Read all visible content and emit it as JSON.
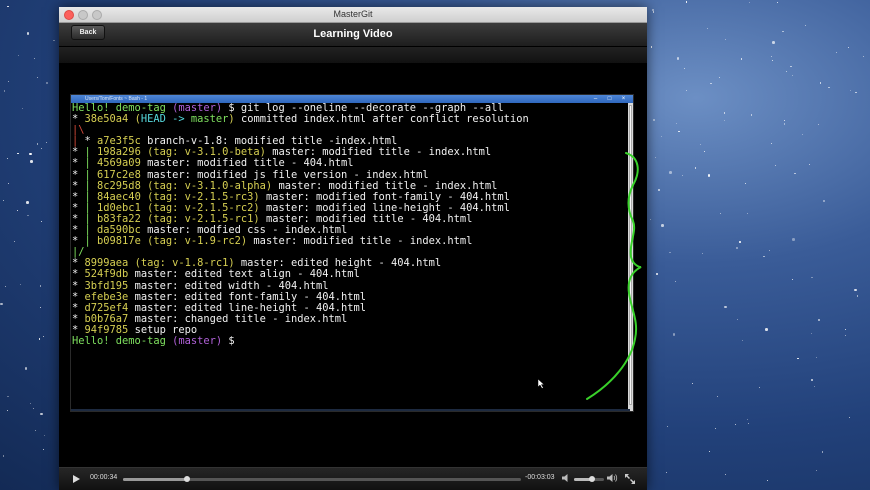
{
  "window": {
    "title": "MasterGit"
  },
  "toolbar": {
    "back_label": "Back",
    "page_title": "Learning Video"
  },
  "terminal": {
    "title": "Users/Tom/Fonts ~ Bash - 1",
    "lines": [
      [
        {
          "t": "Hello! demo-tag ",
          "c": "green"
        },
        {
          "t": "(master)",
          "c": "purple"
        },
        {
          "t": " $ git log --oneline --decorate --graph --all",
          "c": "white"
        }
      ],
      [
        {
          "t": "* ",
          "c": "white"
        },
        {
          "t": "38e50a4 ",
          "c": "yellow"
        },
        {
          "t": "(",
          "c": "yellow"
        },
        {
          "t": "HEAD -> ",
          "c": "cyan"
        },
        {
          "t": "master",
          "c": "green"
        },
        {
          "t": ")",
          "c": "yellow"
        },
        {
          "t": " committed index.html after conflict resolution",
          "c": "white"
        }
      ],
      [
        {
          "t": "|\\",
          "c": "red"
        }
      ],
      [
        {
          "t": "| ",
          "c": "red"
        },
        {
          "t": "* ",
          "c": "white"
        },
        {
          "t": "a7e3f5c ",
          "c": "yellow"
        },
        {
          "t": "branch-v-1.8: modified title -index.html",
          "c": "white"
        }
      ],
      [
        {
          "t": "* ",
          "c": "white"
        },
        {
          "t": "| ",
          "c": "green"
        },
        {
          "t": "198a296 ",
          "c": "yellow"
        },
        {
          "t": "(tag: v-3.1.0-beta)",
          "c": "yellow"
        },
        {
          "t": " master: modified title - index.html",
          "c": "white"
        }
      ],
      [
        {
          "t": "* ",
          "c": "white"
        },
        {
          "t": "| ",
          "c": "green"
        },
        {
          "t": "4569a09 ",
          "c": "yellow"
        },
        {
          "t": "master: modified title - 404.html",
          "c": "white"
        }
      ],
      [
        {
          "t": "* ",
          "c": "white"
        },
        {
          "t": "| ",
          "c": "green"
        },
        {
          "t": "617c2e8 ",
          "c": "yellow"
        },
        {
          "t": "master: modified js file version - index.html",
          "c": "white"
        }
      ],
      [
        {
          "t": "* ",
          "c": "white"
        },
        {
          "t": "| ",
          "c": "green"
        },
        {
          "t": "8c295d8 ",
          "c": "yellow"
        },
        {
          "t": "(tag: v-3.1.0-alpha)",
          "c": "yellow"
        },
        {
          "t": " master: modified title - index.html",
          "c": "white"
        }
      ],
      [
        {
          "t": "* ",
          "c": "white"
        },
        {
          "t": "| ",
          "c": "green"
        },
        {
          "t": "84aec40 ",
          "c": "yellow"
        },
        {
          "t": "(tag: v-2.1.5-rc3)",
          "c": "yellow"
        },
        {
          "t": " master: modified font-family - 404.html",
          "c": "white"
        }
      ],
      [
        {
          "t": "* ",
          "c": "white"
        },
        {
          "t": "| ",
          "c": "green"
        },
        {
          "t": "1d0ebc1 ",
          "c": "yellow"
        },
        {
          "t": "(tag: v-2.1.5-rc2)",
          "c": "yellow"
        },
        {
          "t": " master: modified line-height - 404.html",
          "c": "white"
        }
      ],
      [
        {
          "t": "* ",
          "c": "white"
        },
        {
          "t": "| ",
          "c": "green"
        },
        {
          "t": "b83fa22 ",
          "c": "yellow"
        },
        {
          "t": "(tag: v-2.1.5-rc1)",
          "c": "yellow"
        },
        {
          "t": " master: modified title - 404.html",
          "c": "white"
        }
      ],
      [
        {
          "t": "* ",
          "c": "white"
        },
        {
          "t": "| ",
          "c": "green"
        },
        {
          "t": "da590bc ",
          "c": "yellow"
        },
        {
          "t": "master: modfied css - index.html",
          "c": "white"
        }
      ],
      [
        {
          "t": "* ",
          "c": "white"
        },
        {
          "t": "| ",
          "c": "green"
        },
        {
          "t": "b09817e ",
          "c": "yellow"
        },
        {
          "t": "(tag: v-1.9-rc2)",
          "c": "yellow"
        },
        {
          "t": " master: modified title - index.html",
          "c": "white"
        }
      ],
      [
        {
          "t": "|/",
          "c": "green"
        }
      ],
      [
        {
          "t": "* ",
          "c": "white"
        },
        {
          "t": "8999aea ",
          "c": "yellow"
        },
        {
          "t": "(tag: v-1.8-rc1)",
          "c": "yellow"
        },
        {
          "t": " master: edited height - 404.html",
          "c": "white"
        }
      ],
      [
        {
          "t": "* ",
          "c": "white"
        },
        {
          "t": "524f9db ",
          "c": "yellow"
        },
        {
          "t": "master: edited text align - 404.html",
          "c": "white"
        }
      ],
      [
        {
          "t": "* ",
          "c": "white"
        },
        {
          "t": "3bfd195 ",
          "c": "yellow"
        },
        {
          "t": "master: edited width - 404.html",
          "c": "white"
        }
      ],
      [
        {
          "t": "* ",
          "c": "white"
        },
        {
          "t": "efebe3e ",
          "c": "yellow"
        },
        {
          "t": "master: edited font-family - 404.html",
          "c": "white"
        }
      ],
      [
        {
          "t": "* ",
          "c": "white"
        },
        {
          "t": "d725ef4 ",
          "c": "yellow"
        },
        {
          "t": "master: edited line-height - 404.html",
          "c": "white"
        }
      ],
      [
        {
          "t": "* ",
          "c": "white"
        },
        {
          "t": "b0b76a7 ",
          "c": "yellow"
        },
        {
          "t": "master: changed title - index.html",
          "c": "white"
        }
      ],
      [
        {
          "t": "* ",
          "c": "white"
        },
        {
          "t": "94f9785 ",
          "c": "yellow"
        },
        {
          "t": "setup repo",
          "c": "white"
        }
      ],
      [
        {
          "t": "Hello! demo-tag ",
          "c": "green"
        },
        {
          "t": "(master)",
          "c": "purple"
        },
        {
          "t": " $",
          "c": "white"
        }
      ]
    ]
  },
  "player": {
    "elapsed": "00:00:34",
    "remaining": "-00:03:03",
    "progress": 0.16,
    "volume": 0.6
  },
  "colors": {
    "annotation": "#39d12a",
    "titlebar_blue": "#2f67bd"
  }
}
